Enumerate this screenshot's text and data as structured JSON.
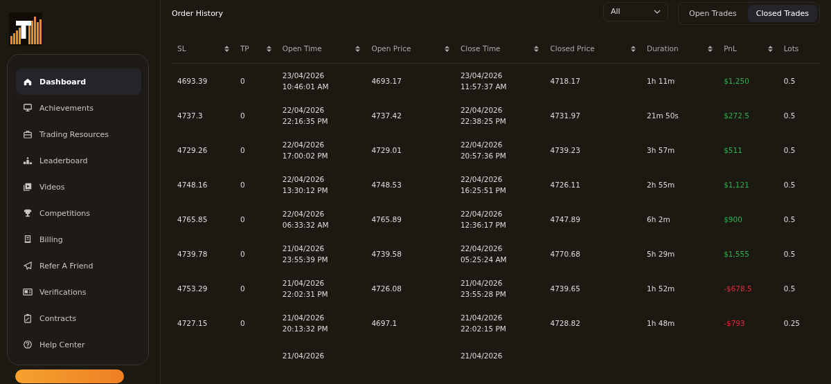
{
  "sidebar": {
    "items": [
      {
        "label": "Dashboard",
        "selected": true
      },
      {
        "label": "Achievements",
        "selected": false
      },
      {
        "label": "Trading Resources",
        "selected": false
      },
      {
        "label": "Leaderboard",
        "selected": false
      },
      {
        "label": "Videos",
        "selected": false
      },
      {
        "label": "Competitions",
        "selected": false
      },
      {
        "label": "Billing",
        "selected": false
      },
      {
        "label": "Refer A Friend",
        "selected": false
      },
      {
        "label": "Verifications",
        "selected": false
      },
      {
        "label": "Contracts",
        "selected": false
      },
      {
        "label": "Help Center",
        "selected": false
      }
    ]
  },
  "order_history": {
    "title": "Order History",
    "filter": {
      "value": "All"
    },
    "tabs": [
      {
        "label": "Open Trades",
        "selected": false
      },
      {
        "label": "Closed Trades",
        "selected": true
      }
    ],
    "table": {
      "columns": [
        {
          "label": "SL",
          "sortable": true
        },
        {
          "label": "TP",
          "sortable": true
        },
        {
          "label": "Open Time",
          "sortable": true
        },
        {
          "label": "Open Price",
          "sortable": true
        },
        {
          "label": "Close Time",
          "sortable": true
        },
        {
          "label": "Closed Price",
          "sortable": true
        },
        {
          "label": "Duration",
          "sortable": true
        },
        {
          "label": "PnL",
          "sortable": true
        },
        {
          "label": "Lots",
          "sortable": false
        }
      ],
      "rows": [
        {
          "sl": "4693.39",
          "tp": "0",
          "open_date": "23/04/2026",
          "open_time": "10:46:01 AM",
          "open_price": "4693.17",
          "close_date": "23/04/2026",
          "close_time": "11:57:37 AM",
          "closed_price": "4718.17",
          "duration": "1h 11m",
          "pnl": "$1,250",
          "kind": "profit",
          "lots": "0.5"
        },
        {
          "sl": "4737.3",
          "tp": "0",
          "open_date": "22/04/2026",
          "open_time": "22:16:35 PM",
          "open_price": "4737.42",
          "close_date": "22/04/2026",
          "close_time": "22:38:25 PM",
          "closed_price": "4731.97",
          "duration": "21m 50s",
          "pnl": "$272.5",
          "kind": "profit",
          "lots": "0.5"
        },
        {
          "sl": "4729.26",
          "tp": "0",
          "open_date": "22/04/2026",
          "open_time": "17:00:02 PM",
          "open_price": "4729.01",
          "close_date": "22/04/2026",
          "close_time": "20:57:36 PM",
          "closed_price": "4739.23",
          "duration": "3h 57m",
          "pnl": "$511",
          "kind": "profit",
          "lots": "0.5"
        },
        {
          "sl": "4748.16",
          "tp": "0",
          "open_date": "22/04/2026",
          "open_time": "13:30:12 PM",
          "open_price": "4748.53",
          "close_date": "22/04/2026",
          "close_time": "16:25:51 PM",
          "closed_price": "4726.11",
          "duration": "2h 55m",
          "pnl": "$1,121",
          "kind": "profit",
          "lots": "0.5"
        },
        {
          "sl": "4765.85",
          "tp": "0",
          "open_date": "22/04/2026",
          "open_time": "06:33:32 AM",
          "open_price": "4765.89",
          "close_date": "22/04/2026",
          "close_time": "12:36:17 PM",
          "closed_price": "4747.89",
          "duration": "6h 2m",
          "pnl": "$900",
          "kind": "profit",
          "lots": "0.5"
        },
        {
          "sl": "4739.78",
          "tp": "0",
          "open_date": "21/04/2026",
          "open_time": "23:55:39 PM",
          "open_price": "4739.58",
          "close_date": "22/04/2026",
          "close_time": "05:25:24 AM",
          "closed_price": "4770.68",
          "duration": "5h 29m",
          "pnl": "$1,555",
          "kind": "profit",
          "lots": "0.5"
        },
        {
          "sl": "4753.29",
          "tp": "0",
          "open_date": "21/04/2026",
          "open_time": "22:02:31 PM",
          "open_price": "4726.08",
          "close_date": "21/04/2026",
          "close_time": "23:55:28 PM",
          "closed_price": "4739.65",
          "duration": "1h 52m",
          "pnl": "-$678.5",
          "kind": "loss",
          "lots": "0.5"
        },
        {
          "sl": "4727.15",
          "tp": "0",
          "open_date": "21/04/2026",
          "open_time": "20:13:32 PM",
          "open_price": "4697.1",
          "close_date": "21/04/2026",
          "close_time": "22:02:15 PM",
          "closed_price": "4728.82",
          "duration": "1h 48m",
          "pnl": "-$793",
          "kind": "loss",
          "lots": "0.25"
        },
        {
          "open_date": "21/04/2026",
          "close_date": "21/04/2026"
        }
      ]
    }
  }
}
